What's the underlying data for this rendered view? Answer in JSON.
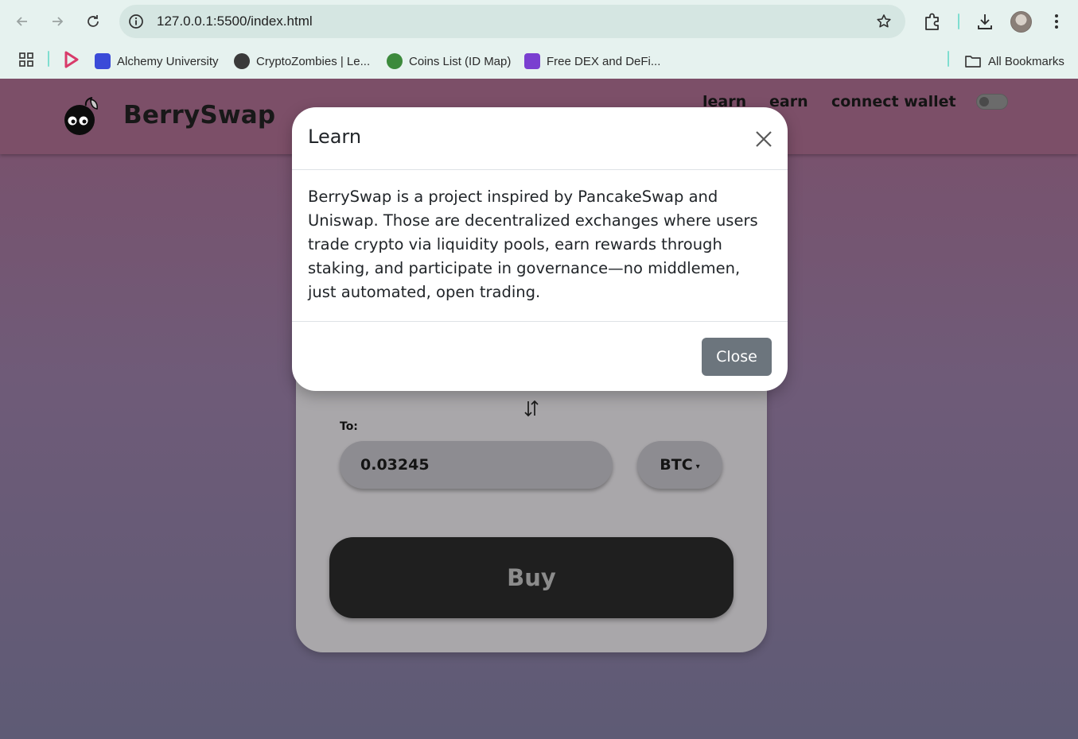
{
  "browser": {
    "url": "127.0.0.1:5500/index.html",
    "bookmarks": [
      {
        "label": "Alchemy University",
        "color": "#3a4bd8"
      },
      {
        "label": "CryptoZombies | Le...",
        "color": "#3a3a3a"
      },
      {
        "label": "Coins List (ID Map)",
        "color": "#3c8a3c"
      },
      {
        "label": "Free DEX and DeFi...",
        "color": "#7a3fd0"
      }
    ],
    "all_bookmarks_label": "All Bookmarks"
  },
  "header": {
    "brand": "BerrySwap",
    "nav": {
      "learn": "learn",
      "earn": "earn",
      "connect_wallet": "connect wallet"
    }
  },
  "swap": {
    "to_label": "To:",
    "to_amount": "0.03245",
    "to_token": "BTC",
    "buy_label": "Buy"
  },
  "modal": {
    "title": "Learn",
    "body": "BerrySwap is a project inspired by PancakeSwap and Uniswap. Those are decentralized exchanges where users trade crypto via liquidity pools, earn rewards through staking, and participate in governance—no middlemen, just automated, open trading.",
    "close_label": "Close"
  },
  "colors": {
    "header_bg": "#7c4f68",
    "card_bg": "#a9a7aa",
    "buy_bg": "#1f1f1f",
    "modal_close_bg": "#6c757d"
  }
}
